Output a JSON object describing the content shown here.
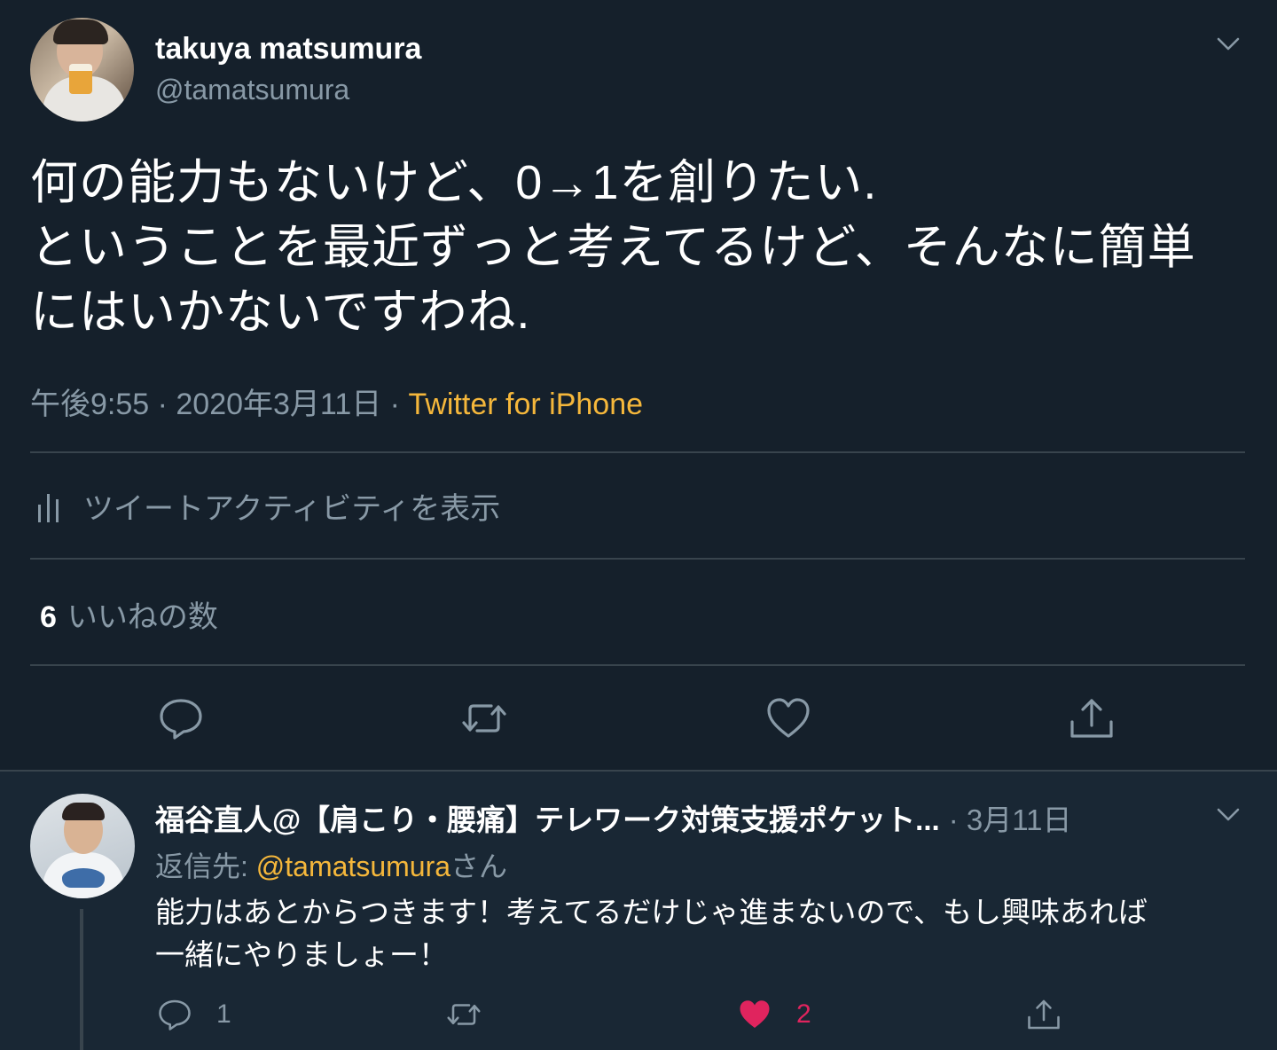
{
  "tweet": {
    "author_name": "takuya matsumura",
    "author_handle": "@tamatsumura",
    "text_lines": [
      "何の能力もないけど、0→1を創りたい.",
      "ということを最近ずっと考えてるけど、そんなに簡単",
      "にはいかないですわね."
    ],
    "timestamp": "午後9:55 · 2020年3月11日 · ",
    "source": "Twitter for iPhone",
    "activity_label": "ツイートアクティビティを表示",
    "like_count": "6",
    "like_label": "いいねの数"
  },
  "reply": {
    "author_name": "福谷直人@【肩こり・腰痛】テレワーク対策支援ポケット...",
    "date": "· 3月11日",
    "reply_to_prefix": "返信先: ",
    "reply_to_handle": "@tamatsumura",
    "reply_to_suffix": "さん",
    "text_lines": [
      "能力はあとからつきます！考えてるだけじゃ進まないので、もし興味あれば",
      "一緒にやりましょー！"
    ],
    "reply_count": "1",
    "like_count": "2"
  },
  "colors": {
    "background": "#15202b",
    "reply_background": "#192734",
    "muted": "#8899a6",
    "accent": "#f5b73b",
    "like": "#e0245e",
    "divider": "#38444d"
  },
  "icons": [
    "chevron-down-icon",
    "bar-chart-icon",
    "reply-icon",
    "retweet-icon",
    "heart-icon",
    "share-icon"
  ]
}
